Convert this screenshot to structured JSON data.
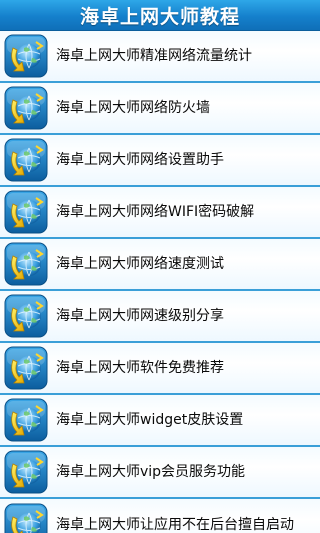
{
  "header": {
    "title": "海卓上网大师教程"
  },
  "icons": {
    "item_icon": "globe-refresh-icon"
  },
  "colors": {
    "title_bar": "#1580cc",
    "divider": "#3a9fd8"
  },
  "items": [
    {
      "label": "海卓上网大师精准网络流量统计"
    },
    {
      "label": "海卓上网大师网络防火墙"
    },
    {
      "label": "海卓上网大师网络设置助手"
    },
    {
      "label": "海卓上网大师网络WIFI密码破解"
    },
    {
      "label": "海卓上网大师网络速度测试"
    },
    {
      "label": "海卓上网大师网速级别分享"
    },
    {
      "label": "海卓上网大师软件免费推荐"
    },
    {
      "label": "海卓上网大师widget皮肤设置"
    },
    {
      "label": "海卓上网大师vip会员服务功能"
    },
    {
      "label": "海卓上网大师让应用不在后台擅自启动"
    }
  ]
}
